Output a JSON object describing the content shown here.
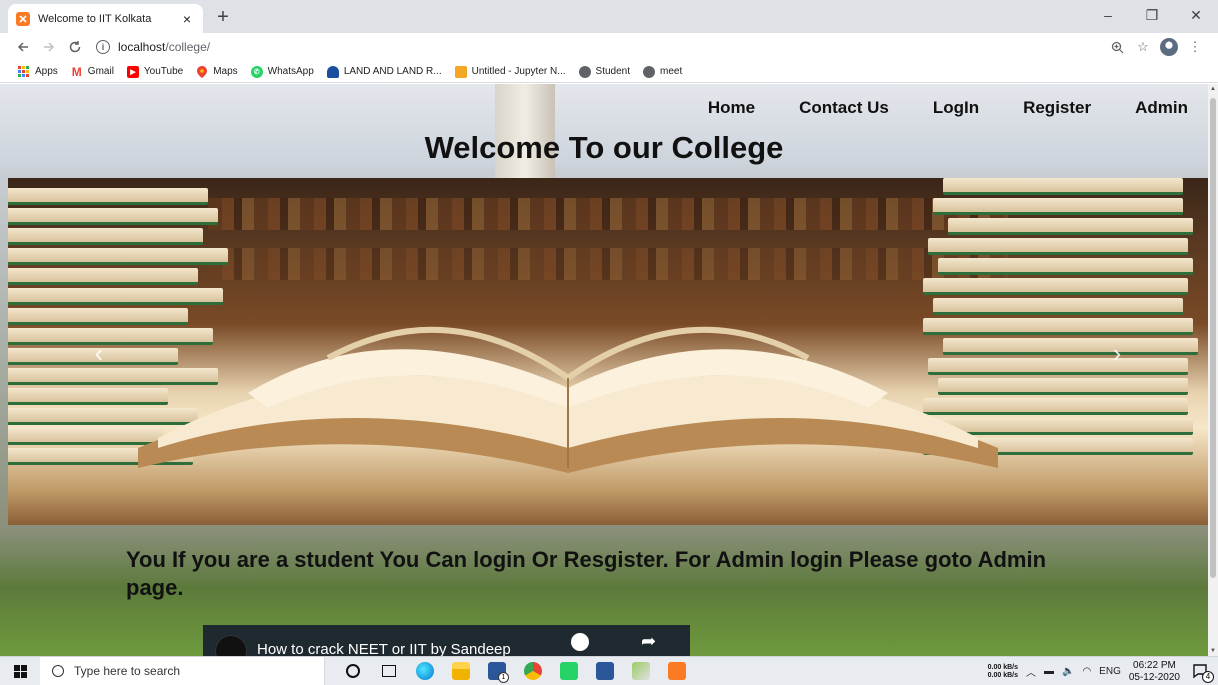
{
  "browser": {
    "tab_title": "Welcome to IIT Kolkata",
    "tab_close": "×",
    "new_tab": "+",
    "url_host": "localhost",
    "url_path": "/college/",
    "window_controls": {
      "minimize": "–",
      "maximize": "❐",
      "close": "✕"
    },
    "bookmarks": [
      {
        "label": "Apps",
        "icon": "apps-grid-icon",
        "color": "#4285f4"
      },
      {
        "label": "Gmail",
        "icon": "gmail-icon",
        "color": "#ea4335"
      },
      {
        "label": "YouTube",
        "icon": "youtube-icon",
        "color": "#ff0000"
      },
      {
        "label": "Maps",
        "icon": "maps-icon",
        "color": "#34a853"
      },
      {
        "label": "WhatsApp",
        "icon": "whatsapp-icon",
        "color": "#25d366"
      },
      {
        "label": "LAND AND LAND R...",
        "icon": "land-icon",
        "color": "#1a4fa0"
      },
      {
        "label": "Untitled - Jupyter N...",
        "icon": "jupyter-icon",
        "color": "#f5a623"
      },
      {
        "label": "Student",
        "icon": "globe-icon",
        "color": "#5f6368"
      },
      {
        "label": "meet",
        "icon": "globe-icon",
        "color": "#5f6368"
      }
    ]
  },
  "page": {
    "nav": [
      "Home",
      "Contact Us",
      "LogIn",
      "Register",
      "Admin"
    ],
    "title": "Welcome To our College",
    "carousel_prev": "‹",
    "carousel_next": "›",
    "message": "You If you are a student You Can login Or Resgister. For Admin login Please goto Admin page.",
    "video_title": "How to crack NEET or IIT by Sandeep"
  },
  "taskbar": {
    "search_placeholder": "Type here to search",
    "netspeed_up": "0.00 kB/s",
    "netspeed_down": "0.00 kB/s",
    "language": "ENG",
    "time": "06:22 PM",
    "date": "05-12-2020",
    "notification_count": "4",
    "mail_badge": "1"
  }
}
